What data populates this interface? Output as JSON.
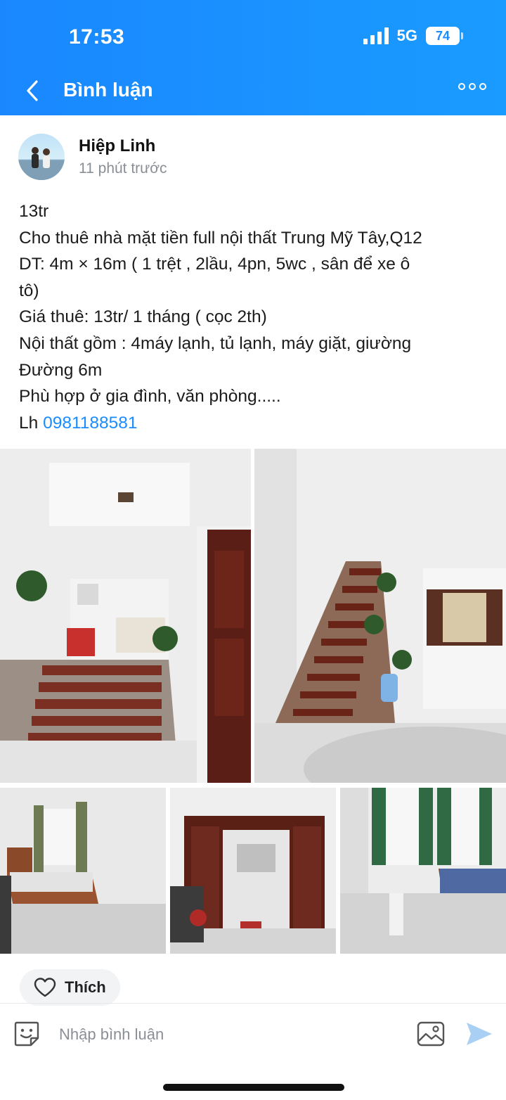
{
  "status_bar": {
    "time": "17:53",
    "network": "5G",
    "battery": "74"
  },
  "header": {
    "title": "Bình luận",
    "back_icon": "chevron-left-icon",
    "more_icon": "more-dots-icon"
  },
  "post": {
    "author": "Hiệp Linh",
    "time_ago": "11 phút trước",
    "lines": [
      "13tr",
      "Cho thuê nhà mặt tiền full nội thất Trung Mỹ Tây,Q12",
      "DT: 4m × 16m ( 1 trệt , 2lầu, 4pn, 5wc , sân để xe ô",
      "tô)",
      "Giá thuê: 13tr/ 1 tháng ( cọc 2th)",
      "Nội thất gồm : 4máy lạnh, tủ lạnh, máy giặt, giường",
      "Đường 6m",
      "Phù hợp ở gia đình, văn phòng....."
    ],
    "contact_prefix": "Lh ",
    "phone": "0981188581"
  },
  "actions": {
    "like_label": "Thích"
  },
  "comment_bar": {
    "placeholder": "Nhập bình luận"
  },
  "colors": {
    "header_blue": "#1a8cff",
    "link_blue": "#1a8cff"
  }
}
